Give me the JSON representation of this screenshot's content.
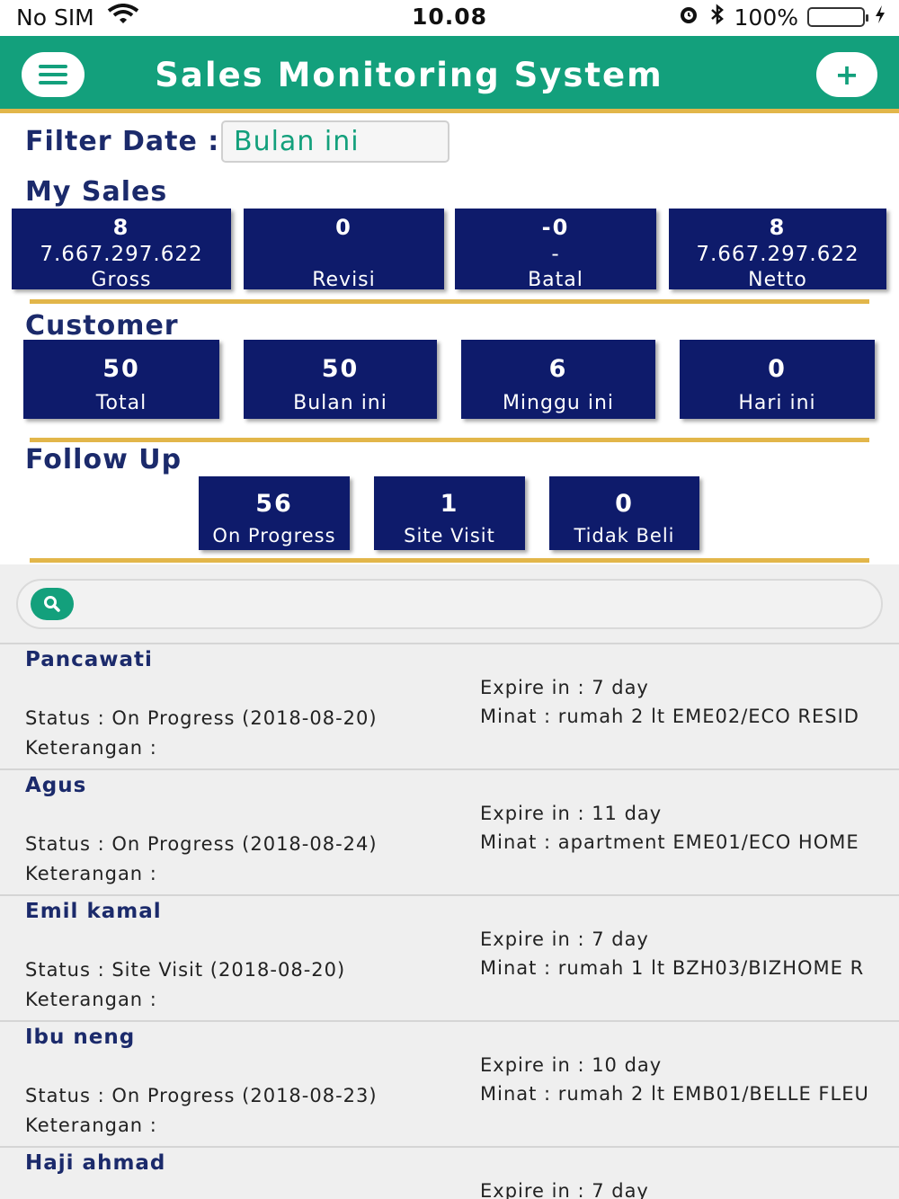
{
  "status_bar": {
    "carrier": "No SIM",
    "time": "10.08",
    "battery": "100%",
    "battery_level": 1.0,
    "icons": [
      "wifi-icon",
      "alarm-icon",
      "bluetooth-icon",
      "battery-icon",
      "charging-icon"
    ]
  },
  "header": {
    "title": "Sales Monitoring System",
    "add_label": "+",
    "icons": [
      "menu-icon",
      "plus-icon"
    ]
  },
  "filter": {
    "label": "Filter Date :",
    "value": "Bulan ini"
  },
  "my_sales": {
    "title": "My Sales",
    "tiles": [
      {
        "count": "8",
        "amount": "7.667.297.622",
        "label": "Gross"
      },
      {
        "count": "0",
        "amount": "",
        "label": "Revisi"
      },
      {
        "count": "-0",
        "amount": "-",
        "label": "Batal"
      },
      {
        "count": "8",
        "amount": "7.667.297.622",
        "label": "Netto"
      }
    ]
  },
  "customer": {
    "title": "Customer",
    "tiles": [
      {
        "count": "50",
        "label": "Total"
      },
      {
        "count": "50",
        "label": "Bulan ini"
      },
      {
        "count": "6",
        "label": "Minggu ini"
      },
      {
        "count": "0",
        "label": "Hari ini"
      }
    ]
  },
  "follow_up": {
    "title": "Follow Up",
    "tiles": [
      {
        "count": "56",
        "label": "On Progress"
      },
      {
        "count": "1",
        "label": "Site Visit"
      },
      {
        "count": "0",
        "label": "Tidak Beli"
      }
    ]
  },
  "search": {
    "placeholder": "",
    "icon": "search-icon"
  },
  "list": [
    {
      "name": "Pancawati",
      "expire": "Expire in : 7 day",
      "status": "Status : On Progress (2018-08-20)",
      "minat": "Minat : rumah 2 lt EME02/ECO RESID",
      "keterangan": "Keterangan :"
    },
    {
      "name": "Agus",
      "expire": "Expire in : 11 day",
      "status": "Status : On Progress (2018-08-24)",
      "minat": "Minat : apartment EME01/ECO HOME",
      "keterangan": "Keterangan :"
    },
    {
      "name": "Emil kamal",
      "expire": "Expire in : 7 day",
      "status": "Status : Site Visit (2018-08-20)",
      "minat": "Minat : rumah 1 lt BZH03/BIZHOME R",
      "keterangan": "Keterangan :"
    },
    {
      "name": "Ibu neng",
      "expire": "Expire in : 10 day",
      "status": "Status : On Progress (2018-08-23)",
      "minat": "Minat : rumah 2 lt EMB01/BELLE FLEU",
      "keterangan": "Keterangan :"
    },
    {
      "name": "Haji ahmad",
      "expire": "Expire in : 7 day",
      "status": "",
      "minat": "",
      "keterangan": ""
    }
  ],
  "colors": {
    "header_green": "#13a07c",
    "gold_divider": "#e2b64a",
    "tile_navy": "#0e1b6b",
    "title_navy": "#1b2a6b"
  }
}
